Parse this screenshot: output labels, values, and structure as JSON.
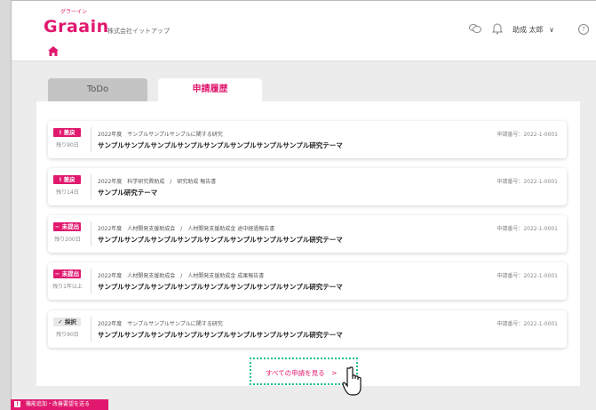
{
  "header": {
    "logo": "Graain",
    "logo_ruby": "グラーイン",
    "company": "株式会社イットアップ",
    "user_name": "助成 太郎",
    "user_chevron": "∨",
    "help": "?"
  },
  "tabs": [
    {
      "label": "ToDo"
    },
    {
      "label": "申請履歴"
    }
  ],
  "applications": [
    {
      "status": "差戻",
      "status_icon": "!",
      "remaining": "残り90日",
      "meta": "2022年度　サンプルサンプルサンプルに関する研究",
      "title": "サンプルサンプルサンプルサンプルサンプルサンプルサンプルサンプル研究テーマ",
      "app_no": "申請番号：2022-1-0001"
    },
    {
      "status": "差戻",
      "status_icon": "!",
      "remaining": "残り14日",
      "meta": "2022年度　科学研究費助成　/　研究助成 報告書",
      "title": "サンプル研究テーマ",
      "app_no": "申請番号：2022-1-0001"
    },
    {
      "status": "未提出",
      "status_icon": "−",
      "remaining": "残り200日",
      "meta": "2022年度　人材開発支援助成会　/　人材開発支援助成金 途中経過報告書",
      "title": "サンプルサンプルサンプルサンプルサンプルサンプルサンプルサンプル研究テーマ",
      "app_no": "申請番号：2022-1-0001"
    },
    {
      "status": "未提出",
      "status_icon": "−",
      "remaining": "残り1年以上",
      "meta": "2022年度　人材開発支援助成会　/　人材開発支援助成金 成果報告書",
      "title": "サンプルサンプルサンプルサンプルサンプルサンプルサンプルサンプル研究テーマ",
      "app_no": "申請番号：2022-1-0001"
    },
    {
      "status": "採択",
      "status_icon": "✓",
      "remaining": "残り90日",
      "meta": "2022年度　サンプルサンプルサンプルに関する研究",
      "title": "サンプルサンプルサンプルサンプルサンプルサンプルサンプルサンプル研究テーマ",
      "app_no": "申請番号：2022-1-0001"
    }
  ],
  "see_all": "すべての申請を見る　>",
  "feedback": "機能追加・改善要望を送る",
  "feedback_icon": "!",
  "icons": [
    "chat-icon",
    "bell-icon",
    "help-icon",
    "home-icon",
    "hand-cursor-icon"
  ],
  "colors": {
    "accent": "#e0196f",
    "highlight": "#17c08f"
  }
}
